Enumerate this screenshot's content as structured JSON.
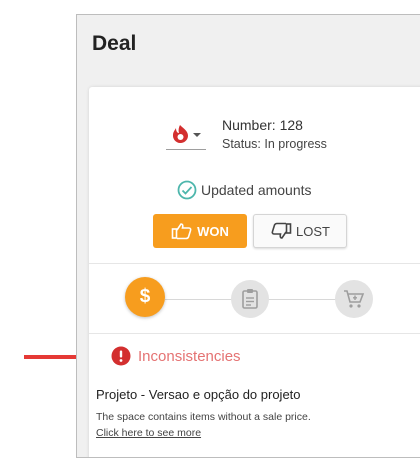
{
  "title": "Deal",
  "deal": {
    "number_label": "Number: 128",
    "status_label": "Status: In progress",
    "temperature_icon": "flame-icon"
  },
  "updated": {
    "label": "Updated amounts",
    "icon": "check-circle-icon"
  },
  "actions": {
    "won_label": "WON",
    "lost_label": "LOST"
  },
  "steps": [
    {
      "label": "$",
      "icon": "dollar-icon",
      "active": true
    },
    {
      "icon": "clipboard-icon",
      "active": false
    },
    {
      "icon": "cart-icon",
      "active": false
    }
  ],
  "inconsistencies": {
    "title": "Inconsistencies",
    "item": "Projeto - Versao e opção do projeto",
    "description": "The space contains items without a sale price.",
    "link": "Click here to see more"
  },
  "colors": {
    "accent": "#f79d1e",
    "warning": "#e53935",
    "success": "#4db6ac",
    "annotation": "#e53935"
  }
}
